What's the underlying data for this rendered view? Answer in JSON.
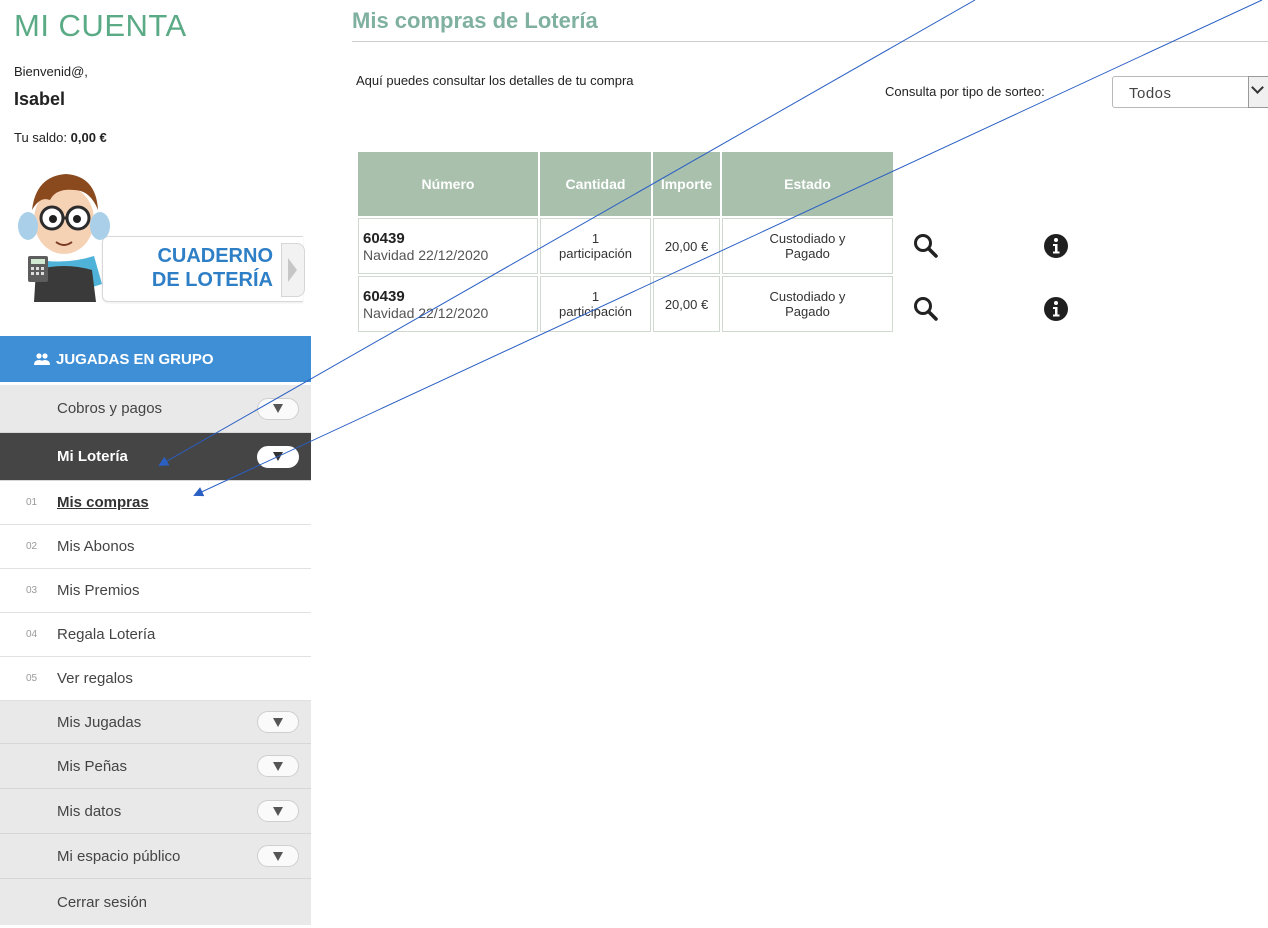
{
  "sidebar": {
    "title": "MI CUENTA",
    "welcome": "Bienvenid@,",
    "username": "Isabel",
    "balance_label": "Tu saldo:",
    "balance_value": "0,00 €",
    "promo": {
      "line1": "CUADERNO",
      "line2": "DE LOTERÍA"
    },
    "group_button": "JUGADAS EN GRUPO",
    "menu": {
      "cobros": "Cobros y pagos",
      "loteria": "Mi Lotería",
      "sub": [
        {
          "num": "01",
          "label": "Mis compras"
        },
        {
          "num": "02",
          "label": "Mis Abonos"
        },
        {
          "num": "03",
          "label": "Mis Premios"
        },
        {
          "num": "04",
          "label": "Regala Lotería"
        },
        {
          "num": "05",
          "label": "Ver regalos"
        }
      ],
      "jugadas": "Mis Jugadas",
      "penas": "Mis Peñas",
      "datos": "Mis datos",
      "espacio": "Mi espacio público",
      "logout": "Cerrar sesión"
    }
  },
  "main": {
    "title": "Mis compras de Lotería",
    "intro": "Aquí puedes consultar los detalles de tu compra",
    "filter_label": "Consulta por tipo de sorteo:",
    "filter_value": "Todos",
    "table": {
      "headers": [
        "Número",
        "Cantidad",
        "Importe",
        "Estado"
      ],
      "rows": [
        {
          "numero": "60439",
          "sorteo": "Navidad 22/12/2020",
          "cantidad_n": "1",
          "cantidad_u": "participación",
          "importe": "20,00 €",
          "estado_1": "Custodiado y",
          "estado_2": "Pagado"
        },
        {
          "numero": "60439",
          "sorteo": "Navidad 22/12/2020",
          "cantidad_n": "1",
          "cantidad_u": "participación",
          "importe": "20,00 €",
          "estado_1": "Custodiado y",
          "estado_2": "Pagado"
        }
      ]
    }
  },
  "colors": {
    "accent_green": "#5aaa86",
    "group_blue": "#3e8fd6",
    "header_green": "#a9c0ad",
    "annotation_blue": "#2a5fc4"
  }
}
